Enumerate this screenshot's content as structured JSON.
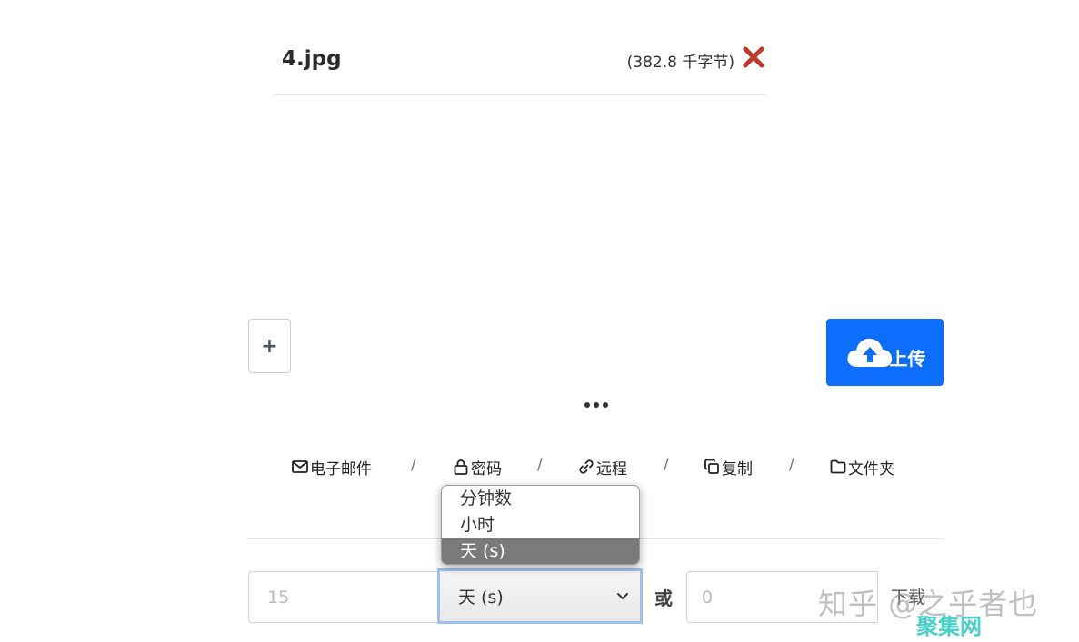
{
  "file": {
    "name": "4.jpg",
    "size": "(382.8 千字节)",
    "remove_icon": "red-x-icon"
  },
  "actions": {
    "add_label": "+",
    "upload_label": "上传",
    "upload_icon": "cloud-upload-icon",
    "more_icon": "ellipsis-icon"
  },
  "options": {
    "items": [
      {
        "label": "电子邮件",
        "icon": "envelope-icon"
      },
      {
        "label": "密码",
        "icon": "lock-icon"
      },
      {
        "label": "远程",
        "icon": "link-icon"
      },
      {
        "label": "复制",
        "icon": "copy-icon"
      },
      {
        "label": "文件夹",
        "icon": "folder-icon"
      }
    ],
    "separator": "/"
  },
  "expiry": {
    "number_placeholder": "15",
    "unit_selected": "天 (s)",
    "unit_options": [
      "分钟数",
      "小时",
      "天 (s)"
    ],
    "or_label": "或",
    "downloads_placeholder": "0",
    "downloads_label": "下载"
  },
  "watermark": {
    "text": "知乎 @之乎者也",
    "sub": "聚集网"
  },
  "colors": {
    "primary": "#0d6efd",
    "danger": "#c0392b",
    "focus_ring": "#9dc1ef",
    "selected_option": "#7a7a7a"
  }
}
